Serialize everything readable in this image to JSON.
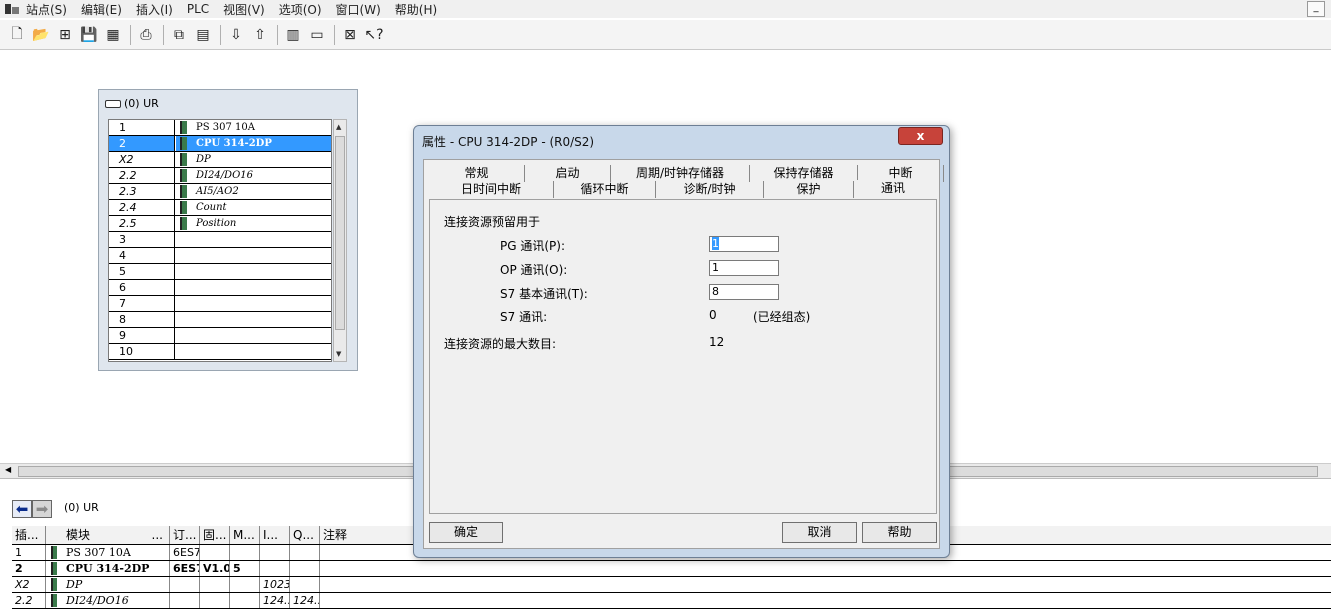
{
  "menubar": {
    "items": [
      "站点(S)",
      "编辑(E)",
      "插入(I)",
      "PLC",
      "视图(V)",
      "选项(O)",
      "窗口(W)",
      "帮助(H)"
    ],
    "minimize": "_"
  },
  "rack": {
    "title": "(0) UR",
    "rows": [
      {
        "slot": "1",
        "module": "PS 307 10A"
      },
      {
        "slot": "2",
        "module": "CPU 314-2DP"
      },
      {
        "slot": "X2",
        "module": "DP"
      },
      {
        "slot": "2.2",
        "module": "DI24/DO16"
      },
      {
        "slot": "2.3",
        "module": "AI5/AO2"
      },
      {
        "slot": "2.4",
        "module": "Count"
      },
      {
        "slot": "2.5",
        "module": "Position"
      },
      {
        "slot": "3",
        "module": ""
      },
      {
        "slot": "4",
        "module": ""
      },
      {
        "slot": "5",
        "module": ""
      },
      {
        "slot": "6",
        "module": ""
      },
      {
        "slot": "7",
        "module": ""
      },
      {
        "slot": "8",
        "module": ""
      },
      {
        "slot": "9",
        "module": ""
      },
      {
        "slot": "10",
        "module": ""
      }
    ]
  },
  "bottom": {
    "title": "(0)     UR",
    "headers": [
      "插...",
      "模块",
      "订...",
      "固...",
      "M...",
      "I...",
      "Q...",
      "注释"
    ],
    "module_dots": "...",
    "rows": [
      {
        "slot": "1",
        "module": "PS 307 10A",
        "order": "6ES7",
        "fw": "",
        "m": "",
        "i": "",
        "q": ""
      },
      {
        "slot": "2",
        "module": "CPU 314-2DP",
        "order": "6ES7",
        "fw": "V1.0",
        "m": "5",
        "i": "",
        "q": ""
      },
      {
        "slot": "X2",
        "module": "DP",
        "order": "",
        "fw": "",
        "m": "",
        "i": "1023*",
        "q": ""
      },
      {
        "slot": "2.2",
        "module": "DI24/DO16",
        "order": "",
        "fw": "",
        "m": "",
        "i": "124...",
        "q": "124..."
      }
    ]
  },
  "dialog": {
    "title": "属性 - CPU 314-2DP - (R0/S2)",
    "close": "x",
    "tabs_row1": [
      "常规",
      "启动",
      "周期/时钟存储器",
      "保持存储器",
      "中断"
    ],
    "tabs_row2": [
      "日时间中断",
      "循环中断",
      "诊断/时钟",
      "保护",
      "通讯"
    ],
    "section_label": "连接资源预留用于",
    "pg_label": "PG 通讯(P):",
    "pg_value": "1",
    "op_label": "OP 通讯(O):",
    "op_value": "1",
    "s7basic_label": "S7 基本通讯(T):",
    "s7basic_value": "8",
    "s7_label": "S7 通讯:",
    "s7_value": "0",
    "s7_note": "(已经组态)",
    "max_label": "连接资源的最大数目:",
    "max_value": "12",
    "ok": "确定",
    "cancel": "取消",
    "help": "帮助"
  }
}
